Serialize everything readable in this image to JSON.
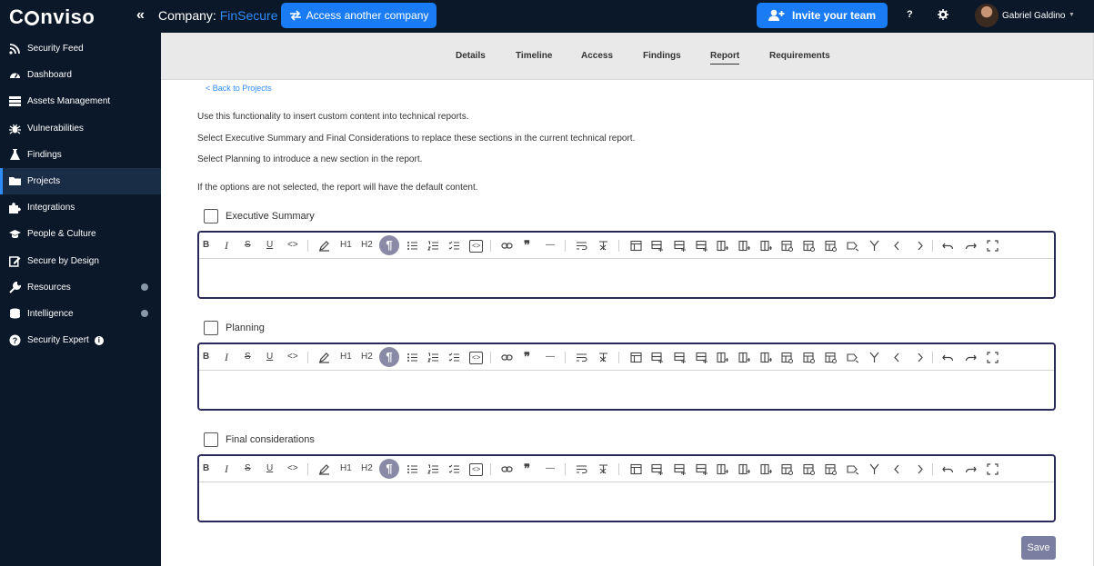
{
  "header": {
    "logo_text": "Conviso",
    "company_label": "Company:",
    "company_name": "FinSecure",
    "access_button": "Access another company",
    "invite_button": "Invite your team",
    "help_label": "?",
    "user_name": "Gabriel Galdino"
  },
  "sidebar": {
    "items": [
      {
        "label": "Security Feed",
        "icon": "rss-icon"
      },
      {
        "label": "Dashboard",
        "icon": "gauge-icon"
      },
      {
        "label": "Assets Management",
        "icon": "server-icon"
      },
      {
        "label": "Vulnerabilities",
        "icon": "bug-icon"
      },
      {
        "label": "Findings",
        "icon": "flask-icon"
      },
      {
        "label": "Projects",
        "icon": "folder-icon",
        "active": true
      },
      {
        "label": "Integrations",
        "icon": "puzzle-icon"
      },
      {
        "label": "People & Culture",
        "icon": "graduation-cap-icon"
      },
      {
        "label": "Secure by Design",
        "icon": "edit-icon"
      },
      {
        "label": "Resources",
        "icon": "wrench-icon",
        "expandable": true
      },
      {
        "label": "Intelligence",
        "icon": "database-icon",
        "expandable": true
      },
      {
        "label": "Security Expert",
        "icon": "question-icon",
        "info": true
      }
    ]
  },
  "tabs": [
    "Details",
    "Timeline",
    "Access",
    "Findings",
    "Report",
    "Requirements"
  ],
  "active_tab": "Report",
  "back_link": "< Back to Projects",
  "description": [
    "Use this functionality to insert custom content into technical reports.",
    "Select Executive Summary and Final Considerations to replace these sections in the current technical report.",
    "Select Planning to introduce a new section in the report.",
    "If the options are not selected, the report will have the default content."
  ],
  "sections": [
    {
      "label": "Executive Summary",
      "checked": false,
      "content": ""
    },
    {
      "label": "Planning",
      "checked": false,
      "content": ""
    },
    {
      "label": "Final considerations",
      "checked": false,
      "content": ""
    }
  ],
  "toolbar_labels": {
    "bold": "B",
    "italic": "I",
    "strike": "S",
    "underline": "U",
    "code": "<>",
    "h1": "H1",
    "h2": "H2",
    "paragraph": "¶",
    "quote": "❞",
    "rule": "—",
    "codeblock": "<>"
  },
  "save_button": "Save",
  "colors": {
    "sidebar_bg": "#0b1829",
    "accent_blue": "#1a7cf5",
    "link_blue": "#2d8cff",
    "editor_border": "#2a2a5a",
    "save_bg": "#7a7ea0"
  }
}
